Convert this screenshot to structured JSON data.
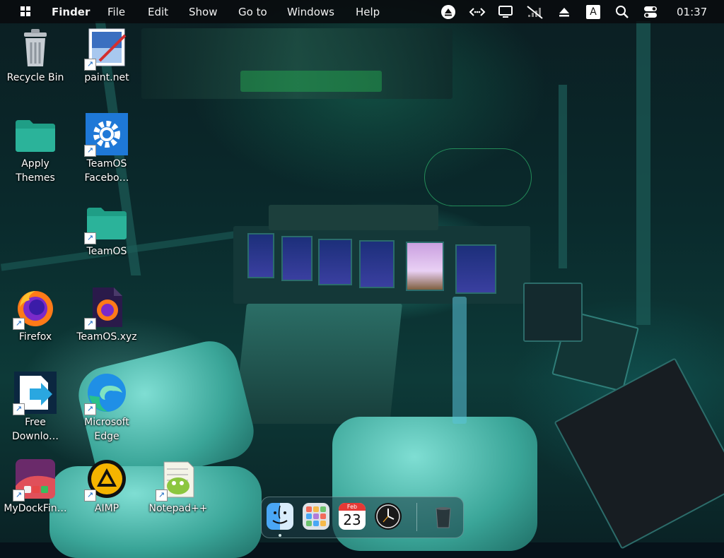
{
  "menubar": {
    "app_name": "Finder",
    "menus": [
      "File",
      "Edit",
      "Show",
      "Go to",
      "Windows",
      "Help"
    ],
    "input_indicator": "A",
    "clock": "01:37"
  },
  "desktop_icons": [
    {
      "label": "Recycle Bin",
      "icon": "recycle-bin-icon"
    },
    {
      "label": "paint.net",
      "icon": "paint-net-icon"
    },
    {
      "label": "Apply Themes",
      "icon": "folder-icon"
    },
    {
      "label": "TeamOS Facebo…",
      "icon": "gear-icon"
    },
    {
      "label": "TeamOS",
      "icon": "folder-icon"
    },
    {
      "label": "Firefox",
      "icon": "firefox-icon"
    },
    {
      "label": "TeamOS.xyz",
      "icon": "firefox-file-icon"
    },
    {
      "label": "Free Downlo…",
      "icon": "download-manager-icon"
    },
    {
      "label": "Microsoft Edge",
      "icon": "edge-icon"
    },
    {
      "label": "MyDockFin…",
      "icon": "mydockfinder-icon"
    },
    {
      "label": "AIMP",
      "icon": "aimp-icon"
    },
    {
      "label": "Notepad++",
      "icon": "notepad-plus-plus-icon"
    }
  ],
  "dock": {
    "calendar_month": "Feb",
    "calendar_day": "23",
    "apps": [
      "finder-icon",
      "launchpad-icon",
      "calendar-icon",
      "clock-icon",
      "trash-icon"
    ]
  },
  "colors": {
    "menubar_bg": "#080a0c",
    "folder_green": "#2bb39a",
    "settings_blue": "#1e78d7",
    "edge_blue": "#1f8fe6"
  }
}
